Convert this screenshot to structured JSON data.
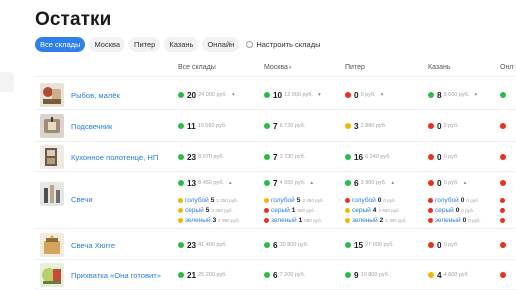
{
  "page_title": "Остатки",
  "tabs": [
    {
      "label": "Все склады",
      "active": true
    },
    {
      "label": "Москва",
      "active": false
    },
    {
      "label": "Питер",
      "active": false
    },
    {
      "label": "Казань",
      "active": false
    },
    {
      "label": "Онлайн",
      "active": false
    }
  ],
  "settings_label": "Настроить склады",
  "columns": [
    "Все склады",
    "Москва",
    "Питер",
    "Казань",
    "Онл"
  ],
  "sort_indicator": "▾",
  "caret_down": "▾",
  "caret_up": "▴",
  "products": [
    {
      "name": "Рыбов, малёк",
      "cells": [
        {
          "status": "green",
          "qty": "20",
          "sum": "24 000 руб."
        },
        {
          "status": "green",
          "qty": "10",
          "sum": "12 000 руб."
        },
        {
          "status": "red",
          "qty": "0",
          "sum": "0 руб."
        },
        {
          "status": "green",
          "qty": "8",
          "sum": "9 600 руб."
        },
        {
          "status": "green",
          "qty": "",
          "sum": ""
        }
      ]
    },
    {
      "name": "Подсвечник",
      "cells": [
        {
          "status": "green",
          "qty": "11",
          "sum": "10 560 руб."
        },
        {
          "status": "green",
          "qty": "7",
          "sum": "6 720 руб."
        },
        {
          "status": "yellow",
          "qty": "3",
          "sum": "2 880 руб."
        },
        {
          "status": "red",
          "qty": "0",
          "sum": "0 руб."
        },
        {
          "status": "red",
          "qty": "",
          "sum": ""
        }
      ]
    },
    {
      "name": "Кухонное полотенце, НП",
      "cells": [
        {
          "status": "green",
          "qty": "23",
          "sum": "8 970 руб."
        },
        {
          "status": "green",
          "qty": "7",
          "sum": "2 730 руб."
        },
        {
          "status": "green",
          "qty": "16",
          "sum": "6 240 руб."
        },
        {
          "status": "red",
          "qty": "0",
          "sum": "0 руб."
        },
        {
          "status": "red",
          "qty": "",
          "sum": ""
        }
      ]
    },
    {
      "name": "Свечи",
      "cells": [
        {
          "status": "green",
          "qty": "13",
          "sum": "8 450 руб."
        },
        {
          "status": "green",
          "qty": "7",
          "sum": "4 550 руб."
        },
        {
          "status": "green",
          "qty": "6",
          "sum": "3 900 руб."
        },
        {
          "status": "red",
          "qty": "0",
          "sum": "0 руб."
        },
        {
          "status": "red",
          "qty": "",
          "sum": ""
        }
      ],
      "variants": [
        [
          {
            "status": "yellow",
            "label": "голубой",
            "qty": "5",
            "sum": "3 250 руб."
          },
          {
            "status": "yellow",
            "label": "серый",
            "qty": "5",
            "sum": "3 250 руб."
          },
          {
            "status": "yellow",
            "label": "зеленый",
            "qty": "3",
            "sum": "1 950 руб."
          }
        ],
        [
          {
            "status": "yellow",
            "label": "голубой",
            "qty": "5",
            "sum": "3 250 руб."
          },
          {
            "status": "red",
            "label": "серый",
            "qty": "1",
            "sum": "650 руб."
          },
          {
            "status": "red",
            "label": "зеленый",
            "qty": "1",
            "sum": "650 руб."
          }
        ],
        [
          {
            "status": "red",
            "label": "голубой",
            "qty": "0",
            "sum": "0 руб."
          },
          {
            "status": "yellow",
            "label": "серый",
            "qty": "4",
            "sum": "2 600 руб."
          },
          {
            "status": "yellow",
            "label": "зеленый",
            "qty": "2",
            "sum": "1 300 руб."
          }
        ],
        [
          {
            "status": "red",
            "label": "голубой",
            "qty": "0",
            "sum": "0 руб."
          },
          {
            "status": "red",
            "label": "серый",
            "qty": "0",
            "sum": "0 руб."
          },
          {
            "status": "red",
            "label": "зеленый",
            "qty": "0",
            "sum": "0 руб."
          }
        ],
        [
          {
            "status": "red",
            "label": "",
            "qty": "",
            "sum": ""
          },
          {
            "status": "red",
            "label": "",
            "qty": "",
            "sum": ""
          },
          {
            "status": "red",
            "label": "",
            "qty": "",
            "sum": ""
          }
        ]
      ]
    },
    {
      "name": "Свеча Хюгге",
      "cells": [
        {
          "status": "green",
          "qty": "23",
          "sum": "41 400 руб."
        },
        {
          "status": "green",
          "qty": "6",
          "sum": "10 800 руб."
        },
        {
          "status": "green",
          "qty": "15",
          "sum": "27 000 руб."
        },
        {
          "status": "red",
          "qty": "0",
          "sum": "0 руб."
        },
        {
          "status": "red",
          "qty": "",
          "sum": ""
        }
      ]
    },
    {
      "name": "Прихватка «Она готовит»",
      "cells": [
        {
          "status": "green",
          "qty": "21",
          "sum": "25 200 руб."
        },
        {
          "status": "green",
          "qty": "6",
          "sum": "7 200 руб."
        },
        {
          "status": "green",
          "qty": "9",
          "sum": "10 800 руб."
        },
        {
          "status": "yellow",
          "qty": "4",
          "sum": "4 800 руб."
        },
        {
          "status": "red",
          "qty": "",
          "sum": ""
        }
      ]
    }
  ],
  "colors": {
    "accent": "#2f80ed",
    "green": "#2bbd4a",
    "red": "#e8321e",
    "yellow": "#f2b705",
    "link": "#2a7de1"
  }
}
